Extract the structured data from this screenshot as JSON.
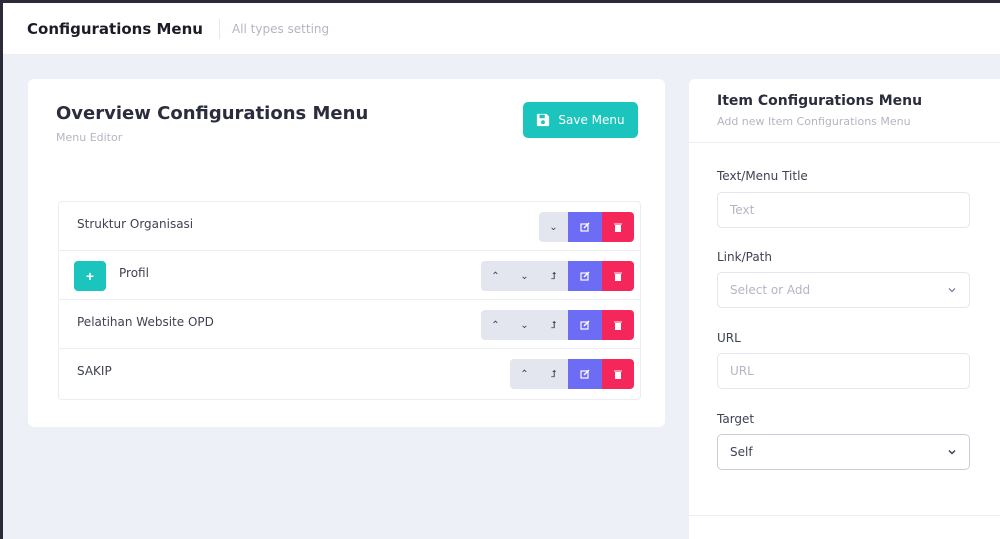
{
  "header": {
    "title": "Configurations Menu",
    "subtitle": "All types setting"
  },
  "overview": {
    "title": "Overview Configurations Menu",
    "subtitle": "Menu Editor",
    "save_label": "Save Menu",
    "items": [
      {
        "label": "Struktur Organisasi"
      },
      {
        "label": "Profil"
      },
      {
        "label": "Pelatihan Website OPD"
      },
      {
        "label": "SAKIP"
      }
    ]
  },
  "item_config": {
    "title": "Item Configurations Menu",
    "subtitle": "Add new Item Configurations Menu",
    "text_label": "Text/Menu Title",
    "text_placeholder": "Text",
    "link_label": "Link/Path",
    "link_placeholder": "Select or Add",
    "url_label": "URL",
    "url_placeholder": "URL",
    "target_label": "Target",
    "target_value": "Self"
  },
  "colors": {
    "primary_teal": "#1bc5bd",
    "edit_blue": "#6c6cf5",
    "delete_red": "#f5275a"
  }
}
